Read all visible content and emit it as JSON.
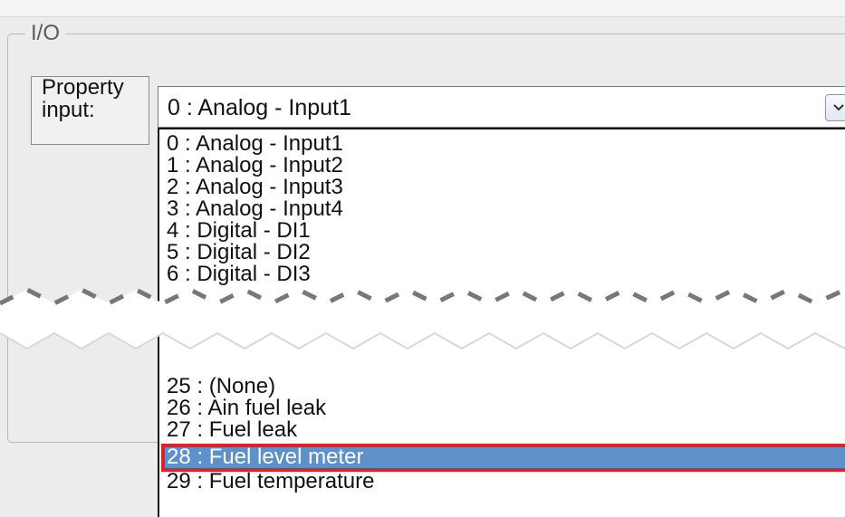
{
  "group": {
    "title": "I/O"
  },
  "property": {
    "label": "Property\ninput:"
  },
  "select": {
    "value": "0 : Analog - Input1"
  },
  "list": {
    "items": [
      "0 : Analog - Input1",
      "1 : Analog - Input2",
      "2 : Analog - Input3",
      "3 : Analog - Input4",
      "4 : Digital - DI1",
      "5 : Digital - DI2",
      "6 : Digital - DI3",
      "25 : (None)",
      "26 : Ain fuel leak",
      "27 : Fuel leak",
      "28 : Fuel level meter",
      "29 : Fuel temperature"
    ],
    "selected_index": 10
  },
  "colors": {
    "selected_background": "#5f91c9",
    "selected_outline": "#de2226",
    "window_background": "#ececec"
  },
  "icons": {
    "dropdown": "chevron-down-icon"
  }
}
